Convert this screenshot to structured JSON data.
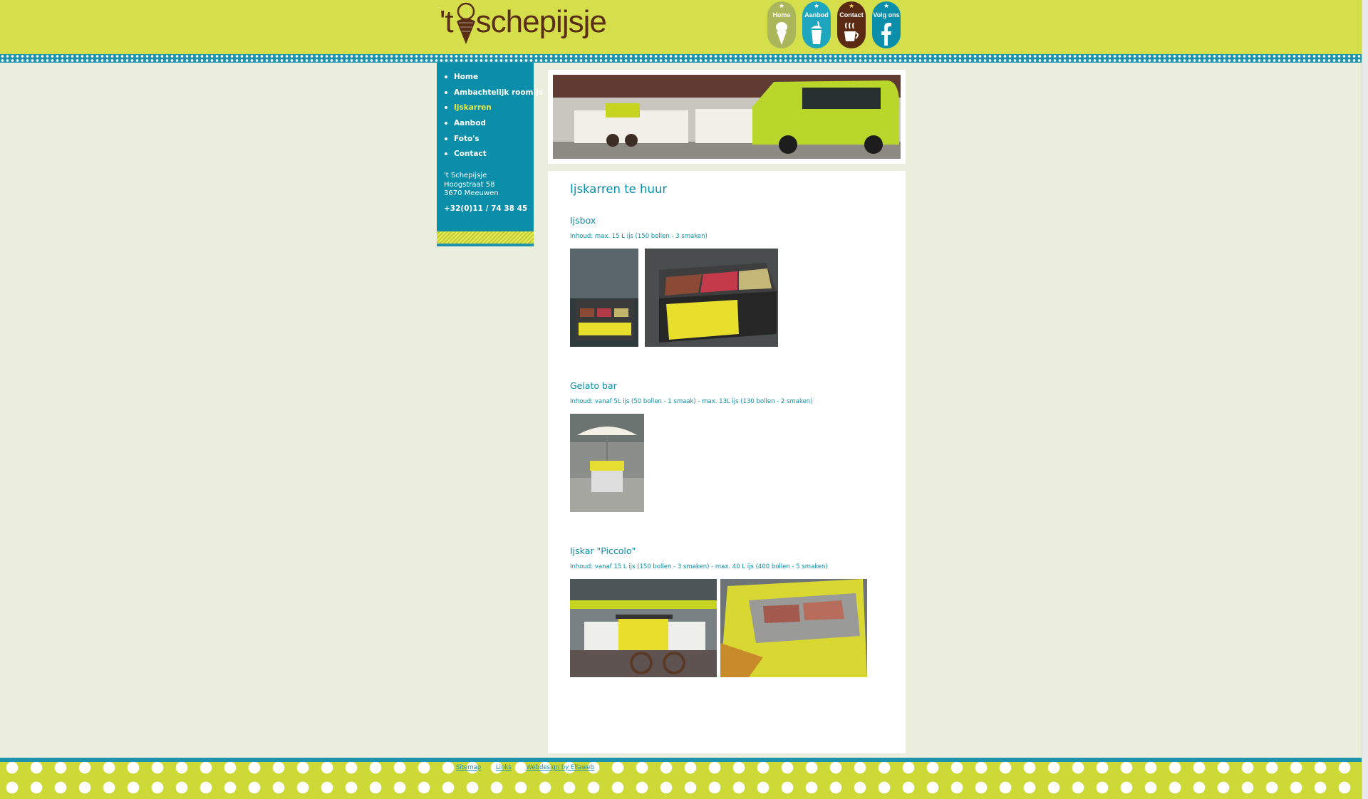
{
  "header": {
    "logo_text": "schepijsje",
    "logo_prefix": "'t",
    "nav": [
      {
        "label": "Home",
        "icon": "ice-cream-cone-icon",
        "color": "#a9b75a"
      },
      {
        "label": "Aanbod",
        "icon": "milkshake-cup-icon",
        "color": "#1ea6bf"
      },
      {
        "label": "Contact",
        "icon": "coffee-cup-icon",
        "color": "#5a2b12"
      },
      {
        "label": "Volg ons",
        "icon": "facebook-icon",
        "color": "#0a8eaa"
      }
    ]
  },
  "sidebar": {
    "items": [
      {
        "label": "Home"
      },
      {
        "label": "Ambachtelijk roomijs"
      },
      {
        "label": "Ijskarren"
      },
      {
        "label": "Aanbod"
      },
      {
        "label": "Foto's"
      },
      {
        "label": "Contact"
      }
    ],
    "address": {
      "name": "'t Schepijsje",
      "street": "Hoogstraat 58",
      "city": "3670 Meeuwen",
      "phone": "+32(0)11 / 74 38 45"
    }
  },
  "main": {
    "title": "Ijskarren te huur",
    "sections": [
      {
        "title": "Ijsbox",
        "subtitle": "Inhoud: max. 15 L ijs (150 bollen - 3 smaken)"
      },
      {
        "title": "Gelato bar",
        "subtitle": "Inhoud: vanaf 5L ijs (50 bollen - 1 smaak) - max. 13L ijs (130 bollen - 2 smaken)"
      },
      {
        "title": "Ijskar \"Piccolo\"",
        "subtitle": "Inhoud: vanaf 15 L ijs (150 bollen - 3 smaken) - max. 40 L ijs (400 bollen - 5 smaken)"
      }
    ]
  },
  "footer": {
    "links": [
      "Sitemap",
      "Links",
      "Webdesign by Ellaweb"
    ]
  },
  "colors": {
    "brand_green": "#d4df4b",
    "brand_blue": "#0a8eaa",
    "brand_brown": "#5a2d15",
    "active_nav": "#ece54a"
  }
}
